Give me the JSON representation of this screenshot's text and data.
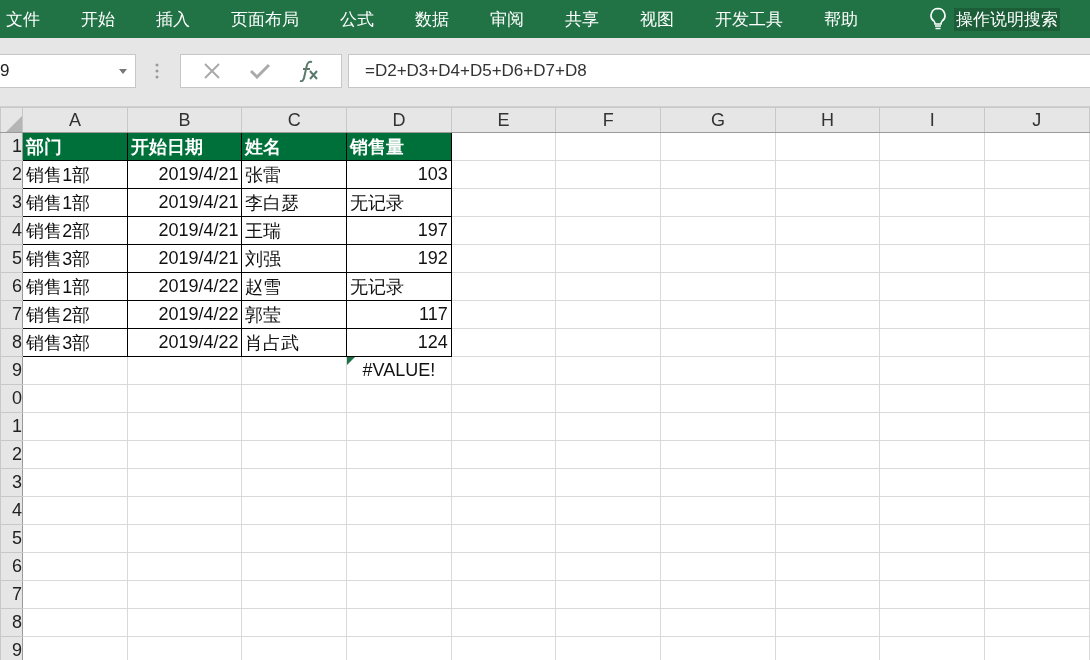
{
  "ribbon_tabs": [
    {
      "label": "文件"
    },
    {
      "label": "开始"
    },
    {
      "label": "插入"
    },
    {
      "label": "页面布局"
    },
    {
      "label": "公式"
    },
    {
      "label": "数据"
    },
    {
      "label": "审阅"
    },
    {
      "label": "共享"
    },
    {
      "label": "视图"
    },
    {
      "label": "开发工具"
    },
    {
      "label": "帮助"
    }
  ],
  "tell_me": {
    "label": "操作说明搜索"
  },
  "name_box": {
    "value": "9"
  },
  "formula_bar": {
    "value": "=D2+D3+D4+D5+D6+D7+D8"
  },
  "columns": [
    "A",
    "B",
    "C",
    "D",
    "E",
    "F",
    "G",
    "H",
    "I",
    "J"
  ],
  "rows": [
    {
      "header": "1",
      "table_header": true,
      "cells": [
        {
          "text": "部门",
          "kind": "text"
        },
        {
          "text": "开始日期",
          "kind": "text"
        },
        {
          "text": "姓名",
          "kind": "text"
        },
        {
          "text": "销售量",
          "kind": "text"
        }
      ]
    },
    {
      "header": "2",
      "table_header": false,
      "cells": [
        {
          "text": "销售1部",
          "kind": "text"
        },
        {
          "text": "2019/4/21",
          "kind": "number"
        },
        {
          "text": "张雷",
          "kind": "text"
        },
        {
          "text": "103",
          "kind": "number"
        }
      ]
    },
    {
      "header": "3",
      "table_header": false,
      "cells": [
        {
          "text": "销售1部",
          "kind": "text"
        },
        {
          "text": "2019/4/21",
          "kind": "number"
        },
        {
          "text": "李白瑟",
          "kind": "text"
        },
        {
          "text": "无记录",
          "kind": "text"
        }
      ]
    },
    {
      "header": "4",
      "table_header": false,
      "cells": [
        {
          "text": "销售2部",
          "kind": "text"
        },
        {
          "text": "2019/4/21",
          "kind": "number"
        },
        {
          "text": "王瑞",
          "kind": "text"
        },
        {
          "text": "197",
          "kind": "number"
        }
      ]
    },
    {
      "header": "5",
      "table_header": false,
      "cells": [
        {
          "text": "销售3部",
          "kind": "text"
        },
        {
          "text": "2019/4/21",
          "kind": "number"
        },
        {
          "text": "刘强",
          "kind": "text"
        },
        {
          "text": "192",
          "kind": "number"
        }
      ]
    },
    {
      "header": "6",
      "table_header": false,
      "cells": [
        {
          "text": "销售1部",
          "kind": "text"
        },
        {
          "text": "2019/4/22",
          "kind": "number"
        },
        {
          "text": "赵雪",
          "kind": "text"
        },
        {
          "text": "无记录",
          "kind": "text"
        }
      ]
    },
    {
      "header": "7",
      "table_header": false,
      "cells": [
        {
          "text": "销售2部",
          "kind": "text"
        },
        {
          "text": "2019/4/22",
          "kind": "number"
        },
        {
          "text": "郭莹",
          "kind": "text"
        },
        {
          "text": "117",
          "kind": "number"
        }
      ]
    },
    {
      "header": "8",
      "table_header": false,
      "cells": [
        {
          "text": "销售3部",
          "kind": "text"
        },
        {
          "text": "2019/4/22",
          "kind": "number"
        },
        {
          "text": "肖占武",
          "kind": "text"
        },
        {
          "text": "124",
          "kind": "number"
        }
      ]
    },
    {
      "header": "9",
      "table_header": false,
      "cells": [
        null,
        null,
        null,
        {
          "text": "#VALUE!",
          "kind": "error",
          "error_indicator": true
        }
      ]
    },
    {
      "header": "0",
      "cells": []
    },
    {
      "header": "1",
      "cells": []
    },
    {
      "header": "2",
      "cells": []
    },
    {
      "header": "3",
      "cells": []
    },
    {
      "header": "4",
      "cells": []
    },
    {
      "header": "5",
      "cells": []
    },
    {
      "header": "6",
      "cells": []
    },
    {
      "header": "7",
      "cells": []
    },
    {
      "header": "8",
      "cells": []
    },
    {
      "header": "9",
      "cells": []
    }
  ]
}
